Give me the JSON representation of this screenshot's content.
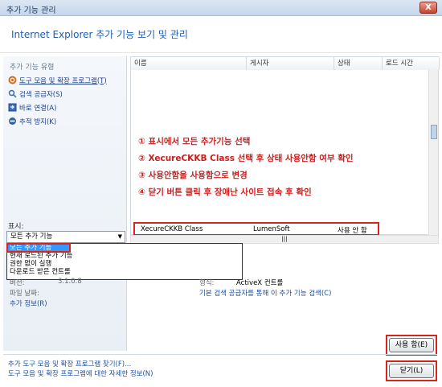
{
  "window": {
    "title": "추가 기능 관리",
    "close_label": "X"
  },
  "header": {
    "title": "Internet Explorer 추가 기능 보기 및 관리"
  },
  "left_panel": {
    "section_label": "추가 기능 유형",
    "items": [
      {
        "label": "도구 모음 및 확장 프로그램(T)",
        "icon": "gear-icon"
      },
      {
        "label": "검색 공급자(S)",
        "icon": "search-icon"
      },
      {
        "label": "바로 연결(A)",
        "icon": "accelerator-icon"
      },
      {
        "label": "추적 방지(K)",
        "icon": "block-icon"
      }
    ],
    "show_label": "표시:",
    "dropdown_value": "모든 추가 기능",
    "dropdown_options": [
      "모든 추가 기능",
      "현재 로드된 추가 기능",
      "권한 없이 실행",
      "다운로드 받은 컨트롤"
    ]
  },
  "table": {
    "columns": [
      "이름",
      "게시자",
      "상태",
      "로드 시간"
    ],
    "row": {
      "name": "XecureCKKB Class",
      "publisher": "LumenSoft",
      "status": "사용 안 함"
    }
  },
  "instructions": [
    "① 표시에서 모든 추가기능 선택",
    "② XecureCKKB Class 선택 후 상태 사용안함 여부 확인",
    "③ 사용안함을 사용함으로 변경",
    "④ 닫기 버튼 클릭 후 장애난 사이트 접속 후 확인"
  ],
  "details": {
    "version_label": "버전:",
    "version_value": "3.1.0.8",
    "file_date_label": "파일 날짜:",
    "more_info_link": "추가 정보(R)",
    "type_label": "형식:",
    "type_value": "ActiveX 컨트롤",
    "search_link": "기본 검색 공급자를 통해 이 추가 기능 검색(C)"
  },
  "footer": {
    "find_more_link": "추가 도구 모음 및 확장 프로그램 찾기(F)...",
    "learn_more_link": "도구 모음 및 확장 프로그램에 대한 자세한 정보(N)",
    "enable_button": "사용 함(E)",
    "close_button": "닫기(L)"
  },
  "colors": {
    "highlight": "#d9241c",
    "instruction_text": "#cc1d1d",
    "link": "#1e4fa3"
  }
}
